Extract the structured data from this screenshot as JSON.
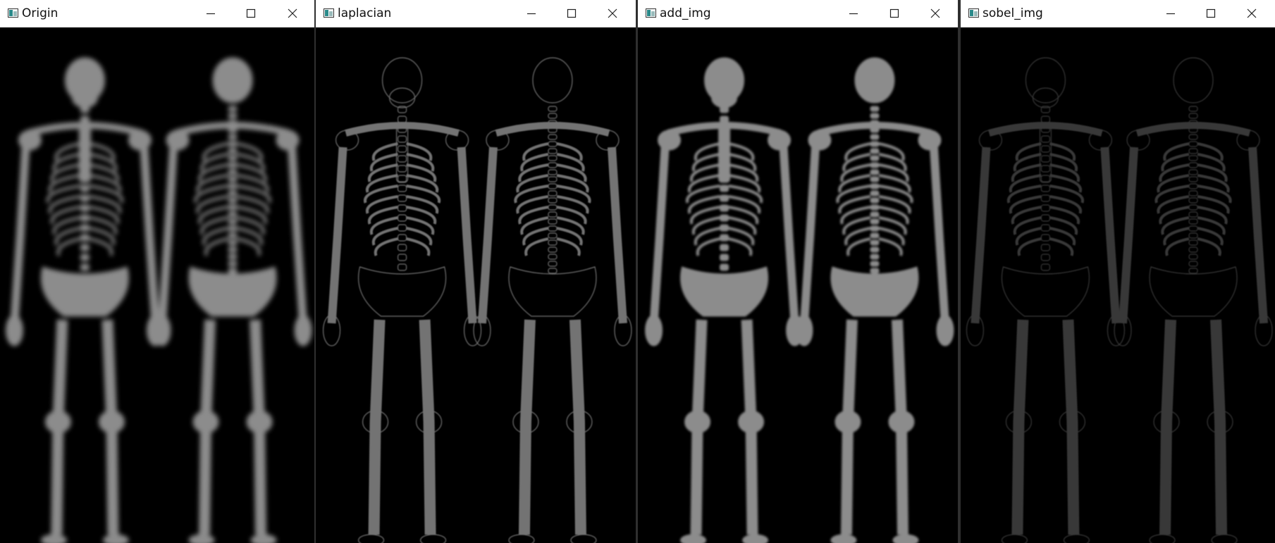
{
  "windows": [
    {
      "id": "origin",
      "title": "Origin",
      "brightness": 1.0,
      "style": "smooth"
    },
    {
      "id": "laplacian",
      "title": "laplacian",
      "brightness": 0.45,
      "style": "edges"
    },
    {
      "id": "add_img",
      "title": "add_img",
      "brightness": 1.0,
      "style": "sharp"
    },
    {
      "id": "sobel_img",
      "title": "sobel_img",
      "brightness": 0.22,
      "style": "edges"
    }
  ],
  "icons": {
    "minimize": "minimize-icon",
    "maximize": "maximize-icon",
    "close": "close-icon",
    "app": "opencv-window-icon"
  },
  "colors": {
    "titlebar": "#ffffff",
    "title_text": "#111111",
    "image_background": "#000000",
    "bone": "#ffffff"
  }
}
